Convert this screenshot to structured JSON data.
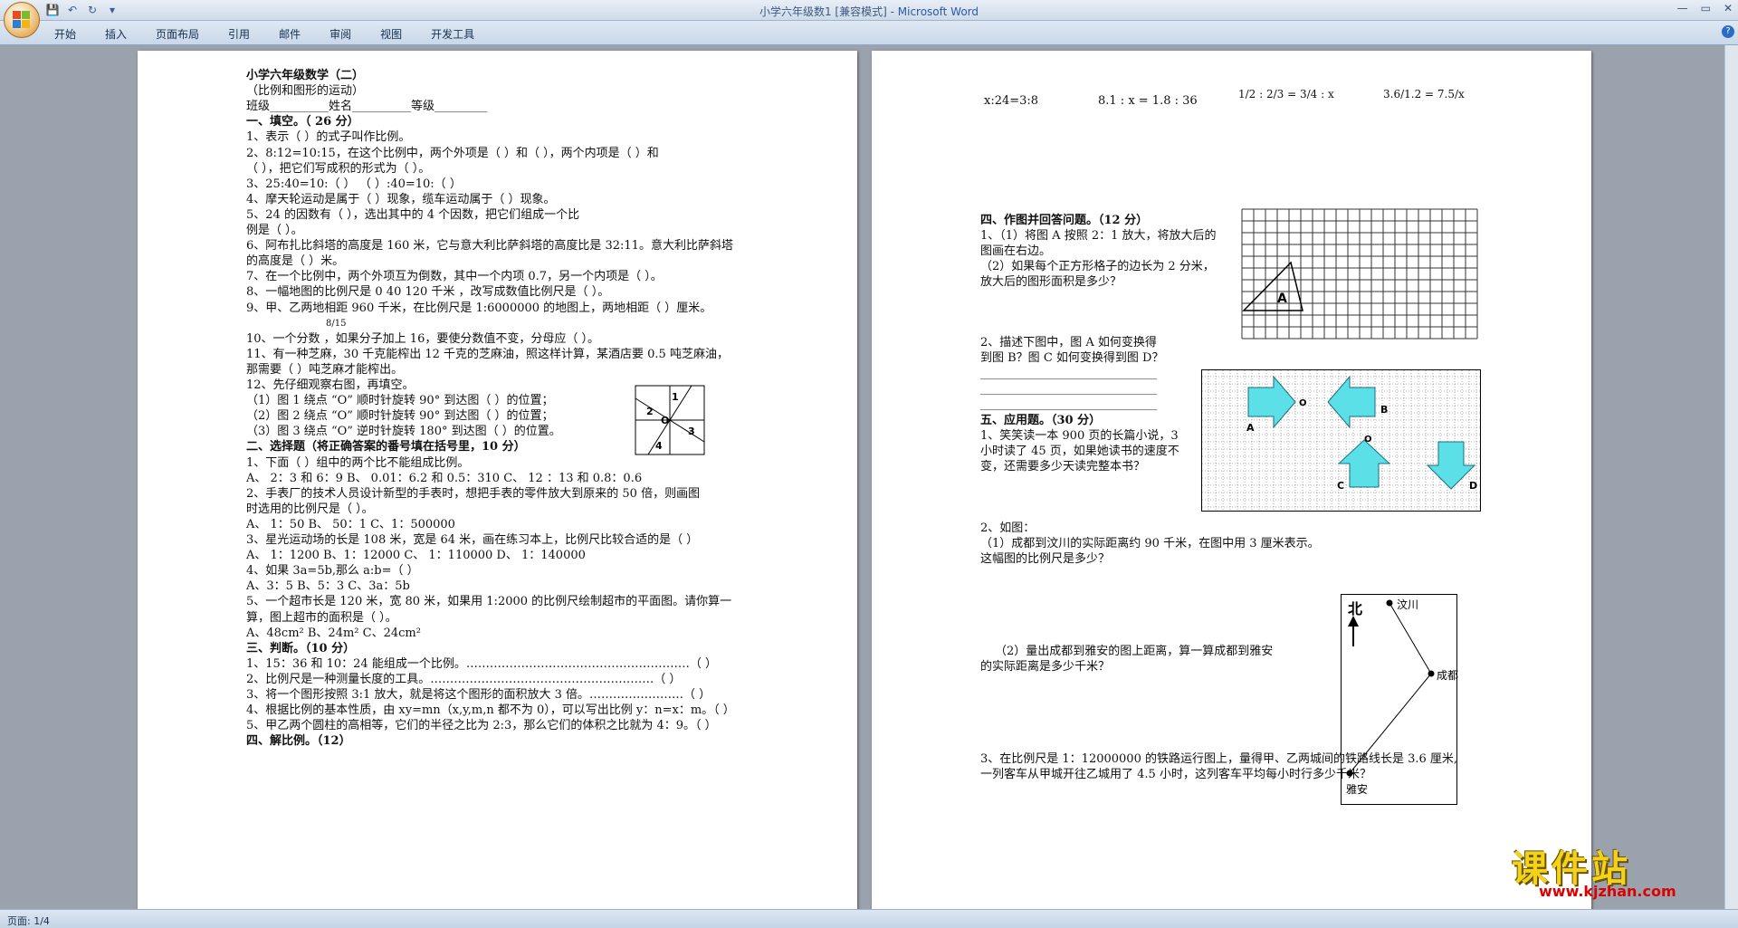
{
  "window": {
    "title": "小学六年级数1 [兼容模式]",
    "title_sep": " - ",
    "app": "Microsoft Word",
    "controls": [
      "—",
      "▭",
      "✕"
    ]
  },
  "ribbon": {
    "tabs": [
      "开始",
      "插入",
      "页面布局",
      "引用",
      "邮件",
      "审阅",
      "视图",
      "开发工具"
    ]
  },
  "statusbar": {
    "page_info": "页面: 1/4"
  },
  "watermark": {
    "brand": "课件站",
    "url": "www.kjzhan.com"
  },
  "page1": [
    {
      "text": "小学六年级数学（二）",
      "bold": true
    },
    {
      "text": "（比例和图形的运动）"
    },
    {
      "text": "班级__________姓名__________等级_________"
    },
    {
      "text": "一、填空。（ 26 分）",
      "bold": true
    },
    {
      "text": "1、表示（                        ）的式子叫作比例。"
    },
    {
      "text": "2、8:12=10:15，在这个比例中，两个外项是（        ）和（      ），两个内项是（        ）和"
    },
    {
      "text": "（          ），把它们写成积的形式为（                              ）。"
    },
    {
      "text": "3、25:40=10:（        ）     （        ）:40=10:（        ）"
    },
    {
      "text": "4、摩天轮运动是属于（            ）现象，缆车运动属于（            ）现象。"
    },
    {
      "text": "5、24 的因数有（                                ），选出其中的 4 个因数，把它们组成一个比"
    },
    {
      "text": "例是（                ）。"
    },
    {
      "text": "6、阿布扎比斜塔的高度是 160 米，它与意大利比萨斜塔的高度比是 32:11。意大利比萨斜塔"
    },
    {
      "text": "的高度是（            ）米。"
    },
    {
      "text": "7、在一个比例中，两个外项互为倒数，其中一个内项 0.7，另一个内项是（            ）。"
    },
    {
      "text": "8、一幅地图的比例尺是  0    40    120 千米 ，改写成数值比例尺是（              ）。"
    },
    {
      "text": "9、甲、乙两地相距 960 千米，在比例尺是 1:6000000 的地图上，两地相距（        ）厘米。"
    },
    {
      "text": "8/15",
      "small": true
    },
    {
      "text": "10、一个分数     ，如果分子加上 16，要使分数值不变，分母应（                ）。"
    },
    {
      "text": "11、有一种芝麻，30 千克能榨出 12 千克的芝麻油，照这样计算，某酒店要 0.5 吨芝麻油，"
    },
    {
      "text": "那需要（            ）吨芝麻才能榨出。"
    },
    {
      "text": "12、先仔细观察右图，再填空。"
    },
    {
      "text": "（1）图 1 绕点 “O” 顺时针旋转 90° 到达图（        ）的位置；"
    },
    {
      "text": "（2）图 2 绕点 “O” 顺时针旋转 90° 到达图（        ）的位置；"
    },
    {
      "text": "（3）图 3 绕点 “O” 逆时针旋转 180° 到达图（        ）的位置。"
    },
    {
      "text": "二、选择题（将正确答案的番号填在括号里，10 分）",
      "bold": true
    },
    {
      "text": "1、下面（      ）组中的两个比不能组成比例。"
    },
    {
      "text": "          A、  2：3 和 6：9      B、 0.01：6.2 和 0.5：310     C、  12 ：13  和 0.8：0.6"
    },
    {
      "text": "2、手表厂的技术人员设计新型的手表时，想把手表的零件放大到原来的 50 倍，则画图"
    },
    {
      "text": "时选用的比例尺是（              ）。"
    },
    {
      "text": "          A、  1：50            B、  50：1          C、1：500000"
    },
    {
      "text": "3、星光运动场的长是 108 米，宽是 64 米，画在练习本上，比例尺比较合适的是（              ）"
    },
    {
      "text": "      A、 1：1200     B、1：12000       C、  1：110000       D、  1：140000"
    },
    {
      "text": "4、如果 3a=5b,那么 a:b=（      ）"
    },
    {
      "text": "A、3：5             B、5：3       C、3a：5b"
    },
    {
      "text": "5、一个超市长是 120 米，宽 80 米，如果用 1:2000 的比例尺绘制超市的平面图。请你算一"
    },
    {
      "text": "算，图上超市的面积是（        ）。"
    },
    {
      "text": "A、48cm²                      B、24m²                       C、24cm²"
    },
    {
      "text": "三、判断。（10 分）",
      "bold": true
    },
    {
      "text": "1、15：36 和 10：24 能组成一个比例。…………………………………………………（      ）"
    },
    {
      "text": "2、比例尺是一种测量长度的工具。…………………………………………………（      ）"
    },
    {
      "text": "3、将一个图形按照 3:1 放大，就是将这个图形的面积放大 3 倍。……………………（      ）"
    },
    {
      "text": "4、根据比例的基本性质，由 xy=mn（x,y,m,n 都不为 0），可以写出比例 y：n=x：m。（      ）"
    },
    {
      "text": "5、甲乙两个圆柱的高相等，它们的半径之比为 2:3，那么它们的体积之比就为 4：9。（      ）"
    },
    {
      "text": "四、解比例。（12）",
      "bold": true
    }
  ],
  "page2_top": {
    "p1": "x:24=3:8",
    "p2": "8.1 : x = 1.8 : 36",
    "p3": "1/2 : 2/3 = 3/4 : x",
    "p4": "3.6/1.2 = 7.5/x"
  },
  "page2": [
    {
      "text": "四、作图并回答问题。（12 分）",
      "bold": true
    },
    {
      "text": "1、（1）将图 A 按照 2：1 放大，将放大后的"
    },
    {
      "text": "图画在右边。"
    },
    {
      "text": "（2）如果每个正方形格子的边长为 2 分米，"
    },
    {
      "text": "放大后的图形面积是多少？"
    },
    {
      "text": "2、描述下图中，图 A 如何变换得"
    },
    {
      "text": "到图 B？图 C 如何变换得到图 D？"
    },
    {
      "text": "______________________________"
    },
    {
      "text": "______________________________"
    },
    {
      "text": "______________________________"
    },
    {
      "text": "五、应用题。（30 分）",
      "bold": true
    },
    {
      "text": "1、笑笑读一本 900 页的长篇小说，3"
    },
    {
      "text": "小时读了 45 页，如果她读书的速度不"
    },
    {
      "text": "变，还需要多少天读完整本书？"
    },
    {
      "text": "2、如图："
    },
    {
      "text": "（1）成都到汶川的实际距离约 90 千米，在图中用 3 厘米表示。"
    },
    {
      "text": "这幅图的比例尺是多少？"
    },
    {
      "text": "（2）量出成都到雅安的图上距离，算一算成都到雅安"
    },
    {
      "text": "的实际距离是多少千米？"
    },
    {
      "text": "3、在比例尺是 1：12000000 的铁路运行图上，量得甲、乙两城间的铁路线长是 3.6 厘米,"
    },
    {
      "text": "一列客车从甲城开往乙城用了 4.5 小时，这列客车平均每小时行多少千米？"
    }
  ],
  "figures": {
    "triangle_label": "A",
    "arrows": [
      "A",
      "O",
      "B",
      "O",
      "C",
      "D"
    ],
    "pinwheel": [
      "1",
      "2",
      "3",
      "4",
      "O"
    ],
    "map": {
      "north": "北",
      "c1": "汶川",
      "c2": "成都",
      "c3": "雅安"
    }
  }
}
